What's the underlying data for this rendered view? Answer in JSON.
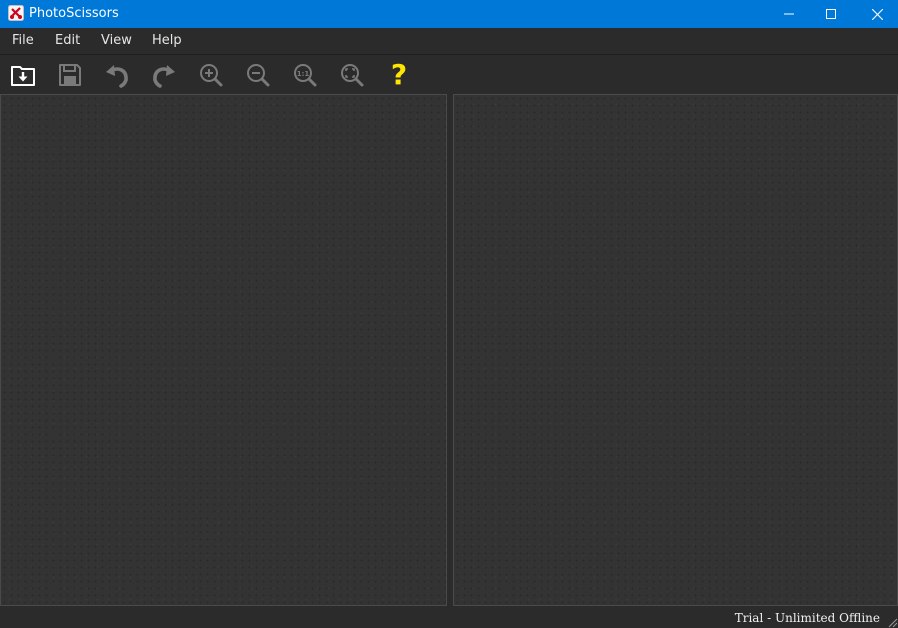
{
  "window": {
    "title": "PhotoScissors",
    "controls": [
      "minimize",
      "maximize",
      "close"
    ]
  },
  "menu": {
    "items": [
      {
        "label": "File"
      },
      {
        "label": "Edit"
      },
      {
        "label": "View"
      },
      {
        "label": "Help"
      }
    ]
  },
  "toolbar": {
    "buttons": [
      {
        "icon": "open-file-icon"
      },
      {
        "icon": "save-icon"
      },
      {
        "icon": "undo-icon"
      },
      {
        "icon": "redo-icon"
      },
      {
        "icon": "zoom-in-icon"
      },
      {
        "icon": "zoom-out-icon"
      },
      {
        "icon": "zoom-actual-size-icon",
        "glyph": "1:1"
      },
      {
        "icon": "zoom-fit-icon"
      },
      {
        "icon": "help-icon",
        "glyph": "?"
      }
    ]
  },
  "panes": {
    "left": "source-image-pane",
    "right": "result-image-pane"
  },
  "status": {
    "text": "Trial - Unlimited Offline"
  },
  "colors": {
    "titlebar": "#0078d7",
    "background": "#2b2b2b",
    "pane": "#333333",
    "help_accent": "#ffe600",
    "icon_active": "#ffffff",
    "icon_disabled": "#7a7a7a"
  }
}
